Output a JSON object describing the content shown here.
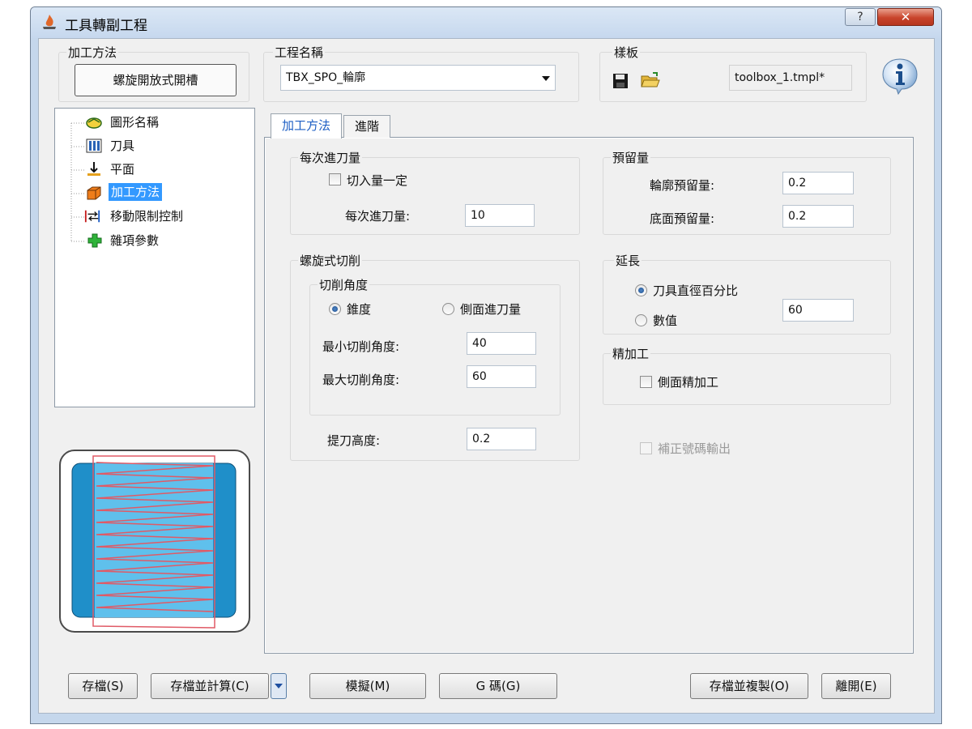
{
  "window": {
    "title": "工具轉副工程",
    "help_label": "?",
    "close_label": "✕"
  },
  "method_group": {
    "label": "加工方法",
    "button": "螺旋開放式開槽"
  },
  "process_name": {
    "label": "工程名稱",
    "value": "TBX_SPO_輪廓"
  },
  "template": {
    "label": "樣板",
    "file": "toolbox_1.tmpl*"
  },
  "tree": {
    "items": [
      {
        "label": "圖形名稱",
        "icon": "shape-icon"
      },
      {
        "label": "刀具",
        "icon": "tool-icon"
      },
      {
        "label": "平面",
        "icon": "plane-icon"
      },
      {
        "label": "加工方法",
        "icon": "method-icon",
        "selected": true
      },
      {
        "label": "移動限制控制",
        "icon": "limit-icon"
      },
      {
        "label": "雜項參數",
        "icon": "misc-icon"
      }
    ]
  },
  "tabs": [
    {
      "label": "加工方法",
      "active": true
    },
    {
      "label": "進階",
      "active": false
    }
  ],
  "feed_per_pass": {
    "label": "每次進刀量",
    "checkbox_label": "切入量一定",
    "field_label": "每次進刀量:",
    "value": "10"
  },
  "helical_cut": {
    "label": "螺旋式切削",
    "angle_group_label": "切削角度",
    "radio_taper": "錐度",
    "radio_side_feed": "側面進刀量",
    "min_angle_label": "最小切削角度:",
    "min_angle_value": "40",
    "max_angle_label": "最大切削角度:",
    "max_angle_value": "60",
    "retract_label": "提刀高度:",
    "retract_value": "0.2"
  },
  "allowance": {
    "label": "預留量",
    "contour_label": "輪廓預留量:",
    "contour_value": "0.2",
    "floor_label": "底面預留量:",
    "floor_value": "0.2"
  },
  "extension": {
    "label": "延長",
    "radio_percent": "刀具直徑百分比",
    "radio_value": "數值",
    "value": "60"
  },
  "finishing": {
    "label": "精加工",
    "checkbox_label": "側面精加工"
  },
  "compensation_output": "補正號碼輸出",
  "buttons": {
    "save": "存檔(S)",
    "save_calc": "存檔並計算(C)",
    "simulate": "模擬(M)",
    "gcode": "G 碼(G)",
    "save_copy": "存檔並複製(O)",
    "close": "離開(E)"
  },
  "colors": {
    "selection": "#3399ff",
    "preview_blue": "#1f8fc9",
    "preview_light": "#5fc0ec",
    "toolpath": "#e05a66"
  }
}
